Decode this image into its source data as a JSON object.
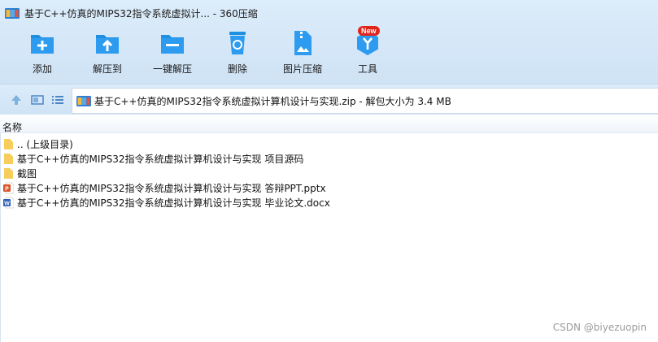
{
  "window": {
    "title": "基于C++仿真的MIPS32指令系统虚拟计... - 360压缩",
    "app_icon": "archive-icon"
  },
  "toolbar": {
    "buttons": [
      {
        "label": "添加",
        "icon": "add-file-icon"
      },
      {
        "label": "解压到",
        "icon": "extract-to-icon"
      },
      {
        "label": "一键解压",
        "icon": "one-click-extract-icon"
      },
      {
        "label": "删除",
        "icon": "trash-icon"
      },
      {
        "label": "图片压缩",
        "icon": "image-compress-icon"
      },
      {
        "label": "工具",
        "icon": "tools-icon",
        "badge": "New"
      }
    ]
  },
  "address": {
    "path": "基于C++仿真的MIPS32指令系统虚拟计算机设计与实现.zip - 解包大小为 3.4 MB",
    "nav_icons": [
      "up-arrow-icon",
      "thumbnail-view-icon",
      "list-view-icon"
    ]
  },
  "list": {
    "column_name": "名称",
    "items": [
      {
        "name": ".. (上级目录)",
        "type": "folder"
      },
      {
        "name": "基于C++仿真的MIPS32指令系统虚拟计算机设计与实现 项目源码",
        "type": "folder"
      },
      {
        "name": "截图",
        "type": "folder"
      },
      {
        "name": "基于C++仿真的MIPS32指令系统虚拟计算机设计与实现  答辩PPT.pptx",
        "type": "pptx"
      },
      {
        "name": "基于C++仿真的MIPS32指令系统虚拟计算机设计与实现 毕业论文.docx",
        "type": "docx"
      }
    ]
  },
  "watermark": "CSDN @biyezuopin",
  "colors": {
    "toolbar_bg": "#d6e8f8",
    "icon_blue": "#1f8fe0",
    "folder_yellow": "#f7cd5c",
    "badge_red": "#e1251b"
  }
}
